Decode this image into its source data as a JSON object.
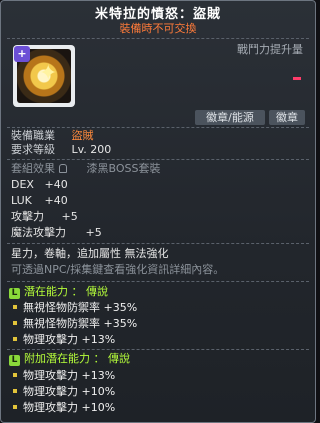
{
  "header": {
    "title": "米特拉的憤怒：盜賊",
    "subtitle": "裝備時不可交換"
  },
  "item": {
    "icon_name": "mitra-rage-emblem-icon",
    "icon_badge": "+",
    "combat_label": "戰鬥力提升量"
  },
  "tags": [
    "徽章/能源",
    "徽章"
  ],
  "requirements": {
    "job_label": "裝備職業",
    "job_value": "盜賊",
    "level_label": "要求等級",
    "level_value": "Lv. 200"
  },
  "set": {
    "label": "套組效果",
    "value": "漆黑BOSS套裝"
  },
  "stats": [
    {
      "label": "DEX",
      "value": "+40"
    },
    {
      "label": "LUK",
      "value": "+40"
    },
    {
      "label": "攻擊力",
      "value": "+5"
    },
    {
      "label": "魔法攻擊力",
      "value": "+5"
    }
  ],
  "notes": {
    "enhance": "星力，卷軸，追加屬性 無法強化",
    "npc": "可透過NPC/採集鍵查看強化資訊詳細內容。"
  },
  "potential": {
    "badge": "L",
    "title": "潛在能力 ： 傳說",
    "lines": [
      "無視怪物防禦率 +35%",
      "無視怪物防禦率 +35%",
      "物理攻擊力 +13%"
    ]
  },
  "additional_potential": {
    "badge": "L",
    "title": "附加潛在能力 ： 傳說",
    "lines": [
      "物理攻擊力 +13%",
      "物理攻擊力 +10%",
      "物理攻擊力 +10%"
    ]
  },
  "colors": {
    "job_value": "#ff8a3c",
    "potential_title": "#b6ff3a",
    "subtitle": "#ff7b3a"
  }
}
